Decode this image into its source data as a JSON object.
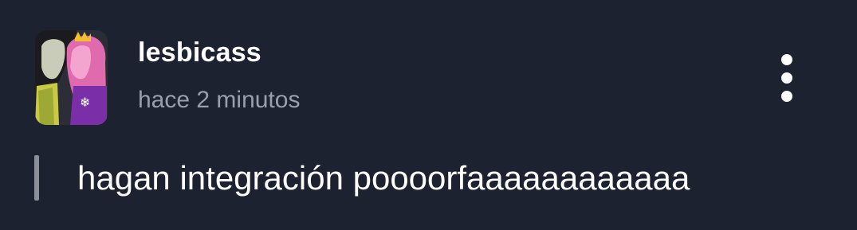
{
  "post": {
    "author": {
      "username": "lesbicass",
      "avatar_icon": "profile-picture"
    },
    "timestamp": "hace 2 minutos",
    "body": "hagan integración poooorfaaaaaaaaaaaa",
    "more_options_icon": "vertical-ellipsis-icon"
  },
  "colors": {
    "background": "#1c2230",
    "username": "#ffffff",
    "timestamp": "#9aa0ab",
    "quote_bar": "#8a8f99",
    "text": "#ffffff"
  }
}
